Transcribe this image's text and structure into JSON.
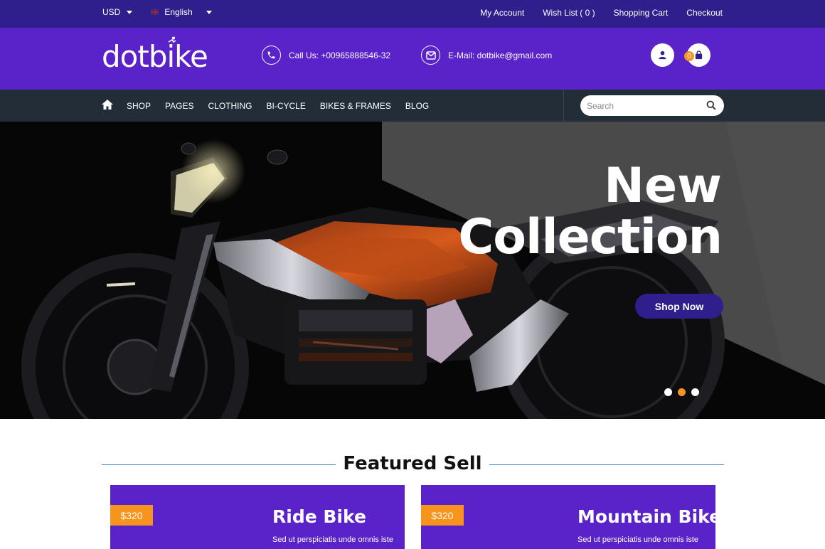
{
  "topbar": {
    "currency": "USD",
    "language": "English",
    "links": [
      "My Account",
      "Wish List ( 0 )",
      "Shopping Cart",
      "Checkout"
    ]
  },
  "header": {
    "logo_text": "dotbike",
    "phone_label": "Call Us: +00965888546-32",
    "email_label": "E-Mail: dotbike@gmail.com",
    "cart_count": "0"
  },
  "nav": {
    "items": [
      "SHOP",
      "PAGES",
      "CLOTHING",
      "BI-CYCLE",
      "BIKES & FRAMES",
      "BLOG"
    ],
    "search_placeholder": "Search"
  },
  "hero": {
    "title_line1": "New",
    "title_line2": "Collection",
    "cta_label": "Shop Now",
    "slides": 3,
    "active_slide": 2
  },
  "featured": {
    "heading": "Featured Sell",
    "cards": [
      {
        "price": "$320",
        "title": "Ride Bike",
        "desc": "Sed ut perspiciatis unde omnis iste"
      },
      {
        "price": "$320",
        "title": "Mountain Bike",
        "desc": "Sed ut perspiciatis unde omnis iste"
      }
    ]
  },
  "colors": {
    "topbar": "#2e1f8c",
    "header": "#5a22c9",
    "nav": "#222d38",
    "accent": "#f7941d"
  }
}
